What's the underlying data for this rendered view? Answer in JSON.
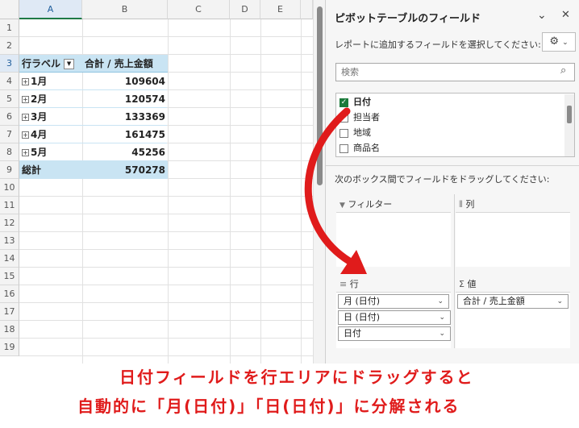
{
  "sheet": {
    "columns": [
      "A",
      "B",
      "C",
      "D",
      "E"
    ],
    "rows": [
      "1",
      "2",
      "3",
      "4",
      "5",
      "6",
      "7",
      "8",
      "9",
      "10",
      "11",
      "12",
      "13",
      "14",
      "15",
      "16",
      "17",
      "18",
      "19"
    ],
    "header_label": "行ラベル",
    "header_value": "合計 / 売上金額",
    "pivot_rows": [
      {
        "label": "1月",
        "value": "109604"
      },
      {
        "label": "2月",
        "value": "120574"
      },
      {
        "label": "3月",
        "value": "133369"
      },
      {
        "label": "4月",
        "value": "161475"
      },
      {
        "label": "5月",
        "value": "45256"
      }
    ],
    "total_label": "総計",
    "total_value": "570278",
    "expand_glyph": "+",
    "dropdown_glyph": "▼"
  },
  "pane": {
    "title": "ピボットテーブルのフィールド",
    "chevron_glyph": "⌄",
    "close_glyph": "✕",
    "subtitle": "レポートに追加するフィールドを選択してください:",
    "gear_glyph": "⚙",
    "gear_chev": "⌄",
    "search_placeholder": "検索",
    "search_glyph": "⌕",
    "fields": [
      {
        "label": "日付",
        "checked": true
      },
      {
        "label": "担当者",
        "checked": false
      },
      {
        "label": "地域",
        "checked": false
      },
      {
        "label": "商品名",
        "checked": false
      }
    ],
    "check_glyph": "✓",
    "drag_note": "次のボックス間でフィールドをドラッグしてください:",
    "areas": {
      "filter": {
        "icon": "▼",
        "label": "フィルター"
      },
      "columns": {
        "icon": "⦀",
        "label": "列"
      },
      "rows": {
        "icon": "≡",
        "label": "行",
        "items": [
          "月 (日付)",
          "日 (日付)",
          "日付"
        ]
      },
      "values": {
        "icon": "Σ",
        "label": "値",
        "items": [
          "合計 / 売上金額"
        ]
      }
    },
    "pill_chevron": "⌄"
  },
  "annotation": {
    "line1": "日付フィールドを行エリアにドラッグすると",
    "line2": "自動的に「月(日付)」「日(日付)」に分解される",
    "color": "#e01b1b"
  }
}
